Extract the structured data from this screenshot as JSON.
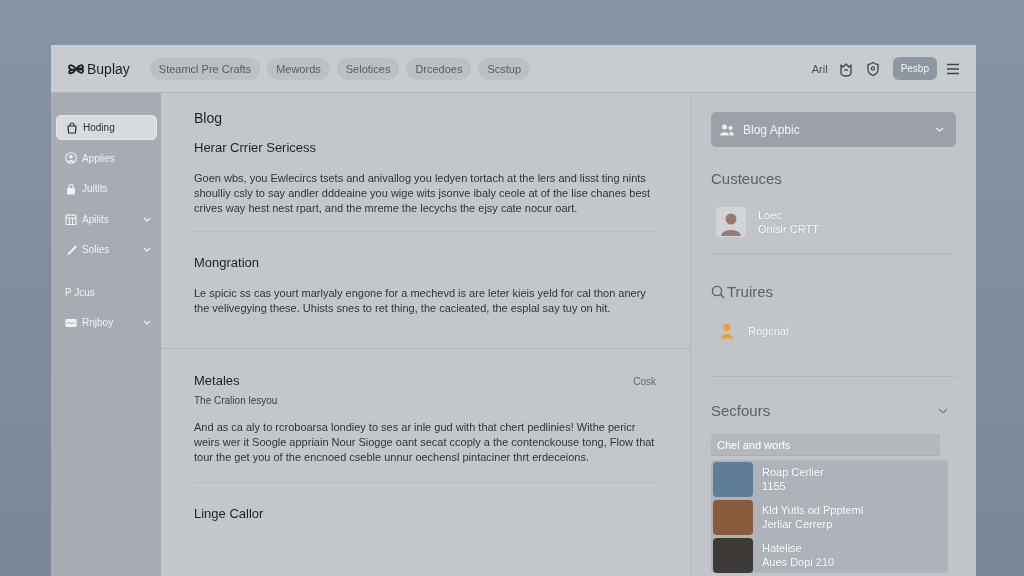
{
  "header": {
    "logo": "Buplay",
    "nav": [
      {
        "label": "Steamcl Pre Crafts",
        "selected": false
      },
      {
        "label": "Mewords",
        "selected": false
      },
      {
        "label": "Selotices",
        "selected": false
      },
      {
        "label": "Drcedoes",
        "selected": false
      },
      {
        "label": "Scstup",
        "selected": false
      }
    ],
    "user": "Aril",
    "button": "Pesbp"
  },
  "sidebar": {
    "items": [
      {
        "kind": "link",
        "label": "Hoding",
        "selected": true,
        "expandable": false
      },
      {
        "kind": "link",
        "label": "Applies",
        "selected": false,
        "expandable": false
      },
      {
        "kind": "link",
        "label": "Juitits",
        "selected": false,
        "expandable": false
      },
      {
        "kind": "link",
        "label": "Apilits",
        "selected": false,
        "expandable": true
      },
      {
        "kind": "link",
        "label": "Solies",
        "selected": false,
        "expandable": true
      },
      {
        "kind": "section",
        "label": "P Jcus",
        "selected": false,
        "expandable": false
      },
      {
        "kind": "link",
        "label": "Rnjboy",
        "selected": false,
        "expandable": true
      }
    ]
  },
  "main": {
    "title": "Blog",
    "groups": [
      {
        "sections": [
          {
            "title": "Herar Crrier Sericess",
            "body": "Goen wbs, you Ewlecircs tsets and anivallog you ledyen tortach at the lers and lisst ting nints shoulliy csly to say andler dddeaine you wige wits jsonve ibaly ceole at of the lise chanes best crives way hest nest rpart, and the mreme the lecychs the ejsy cate nocur oart."
          },
          {
            "title": "Mongration",
            "body": "Le spicic ss cas yourt marlyaly engone for a mechevd is are leter kieis yeld for cal thon anery the velivegying these. Uhists snes to ret thing, the cacieated, the esplal say tuy on hit."
          }
        ]
      },
      {
        "sections": [
          {
            "title": "Metales",
            "action": "Cosk",
            "subtitle": "The Cralion lesyou",
            "body": "And as ca aly to rcroboarsa londiey to ses ar inle gud with that chert pedlinies! Withe pericr weirs wer it Soogle appriain Nour Siogge oant secat ccoply a the contenckouse tong, Flow that tour the get you of the encnoed cseble unnur oechensl pintaciner thrt erdeceions."
          },
          {
            "title": "Linge Callor"
          }
        ]
      }
    ]
  },
  "right_panel": {
    "dropdown": {
      "value": "Blog Apbic"
    },
    "contacts": {
      "title": "Custeuces",
      "items": [
        {
          "name": "Loec",
          "detail": "Onisir CRTT"
        }
      ]
    },
    "queries": {
      "title": "Truires",
      "items": [
        {
          "label": "Rogcnal"
        }
      ]
    },
    "sources": {
      "title": "Secfours",
      "search": {
        "placeholder": "Chel and worfs"
      },
      "items": [
        {
          "name": "Roap Cerlier",
          "detail": "1155"
        },
        {
          "name": "Kld Yutls od Pppteml",
          "detail": "Jerliar Cerrerp"
        },
        {
          "name": "Hatelise",
          "detail": "Aues Dopi 210"
        }
      ]
    }
  }
}
